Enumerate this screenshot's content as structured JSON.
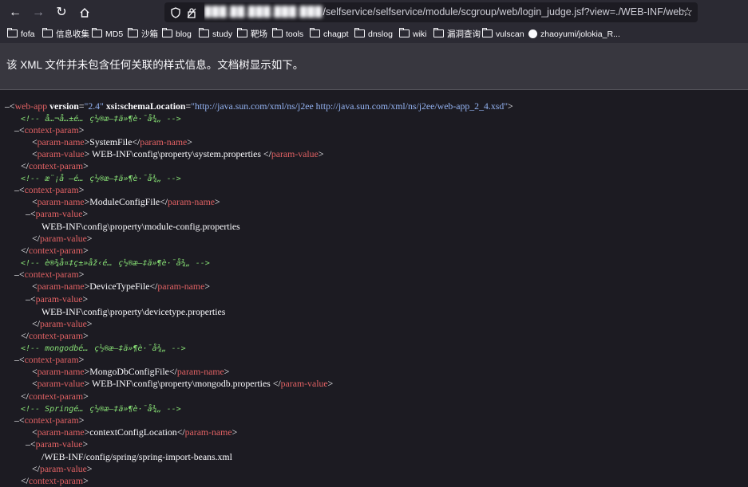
{
  "browser": {
    "url_blurred": "▉▉▉.▉▉.▉▉▉.▉▉▉:▉▉▉",
    "url_path": "/selfservice/selfservice/module/scgroup/web/login_judge.jsf?view=./WEB-INF/web"
  },
  "bookmarks": [
    "fofa",
    "信息收集",
    "MD5",
    "沙箱",
    "blog",
    "study",
    "靶场",
    "tools",
    "chagpt",
    "dnslog",
    "wiki",
    "漏洞查询",
    "vulscan",
    "zhaoyumi/jolokia_R..."
  ],
  "info_message": "该 XML 文件并未包含任何关联的样式信息。文档树显示如下。",
  "xml": {
    "root_tag": "web-app",
    "version_attr": "version",
    "version_val": "\"2.4\"",
    "schema_attr": "xsi:schemaLocation",
    "schema_val": "\"http://java.sun.com/xml/ns/j2ee http://java.sun.com/xml/ns/j2ee/web-app_2_4.xsd\"",
    "comment1": "<!-- å…¬å…±é…ç½®æ–‡ä»¶è·¯å¾„ -->",
    "comment2": "<!-- æ¨¡å—é…ç½®æ–‡ä»¶è·¯å¾„ -->",
    "comment3": "<!-- è®¾å¤‡ç±»åž‹é…ç½®æ–‡ä»¶è·¯å¾„ -->",
    "comment4": "<!-- mongodbé…ç½®æ–‡ä»¶è·¯å¾„ -->",
    "comment5": "<!-- Springé…ç½®æ–‡ä»¶è·¯å¾„ -->",
    "ctx_tag": "context-param",
    "pname_tag": "param-name",
    "pvalue_tag": "param-value",
    "name1": "SystemFile",
    "value1": " WEB-INF\\config\\property\\system.properties ",
    "name2": "ModuleConfigFile",
    "value2": "WEB-INF\\config\\property\\module-config.properties",
    "name3": "DeviceTypeFile",
    "value3": "WEB-INF\\config\\property\\devicetype.properties",
    "name4": "MongoDbConfigFile",
    "value4": " WEB-INF\\config\\property\\mongodb.properties ",
    "name5": "contextConfigLocation",
    "value5": "/WEB-INF/config/spring/spring-import-beans.xml"
  }
}
